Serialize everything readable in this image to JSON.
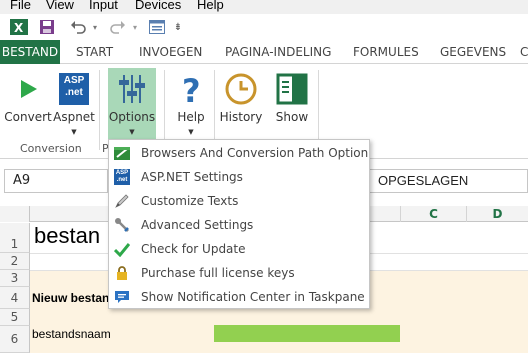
{
  "menubar": {
    "items": [
      "File",
      "View",
      "Input",
      "Devices",
      "Help"
    ]
  },
  "ribbon_tabs": [
    "BESTAND",
    "START",
    "INVOEGEN",
    "PAGINA-INDELING",
    "FORMULES",
    "GEGEVENS",
    "C"
  ],
  "ribbon": {
    "buttons": [
      {
        "label": "Convert",
        "icon": "play-icon"
      },
      {
        "label": "Aspnet",
        "icon": "aspnet-icon",
        "icon_text": "ASP .net"
      },
      {
        "label": "Options",
        "icon": "sliders-icon"
      },
      {
        "label": "Help",
        "icon": "question-icon"
      },
      {
        "label": "History",
        "icon": "clock-icon"
      },
      {
        "label": "Show",
        "icon": "panel-icon"
      }
    ],
    "groups": [
      "Conversion",
      "P"
    ]
  },
  "formula_bar": {
    "name_box": "A9",
    "value": "OPGESLAGEN"
  },
  "grid": {
    "columns": [
      "C",
      "D"
    ],
    "rows": [
      "1",
      "2",
      "3",
      "4",
      "5",
      "6"
    ],
    "cells": {
      "r1": "bestan",
      "r4": "Nieuw bestan",
      "r6": "bestandsnaam"
    }
  },
  "dropdown": {
    "items": [
      {
        "label": "Browsers And Conversion Path Option",
        "icon": "browsers-icon"
      },
      {
        "label": "ASP.NET Settings",
        "icon": "aspnet-small-icon",
        "icon_text": "ASP .net"
      },
      {
        "label": "Customize Texts",
        "icon": "pencil-icon"
      },
      {
        "label": "Advanced Settings",
        "icon": "wrench-icon"
      },
      {
        "label": "Check for Update",
        "icon": "checkmark-icon"
      },
      {
        "label": "Purchase full license keys",
        "icon": "lock-icon"
      },
      {
        "label": "Show Notification Center in Taskpane",
        "icon": "notification-icon"
      }
    ]
  },
  "colors": {
    "excel_green": "#217346",
    "options_active": "#a9d8b8",
    "bar_green": "#92d050",
    "shade": "#fdf3e1"
  }
}
